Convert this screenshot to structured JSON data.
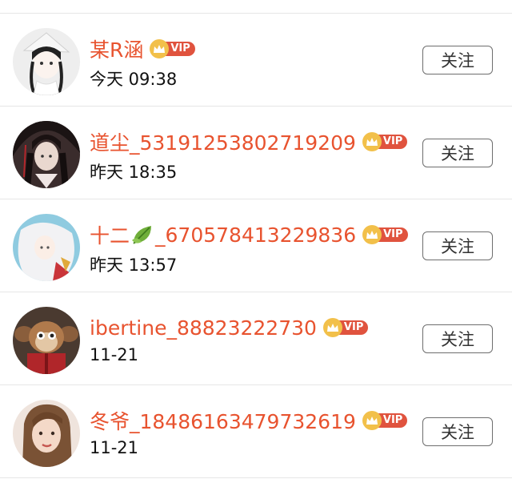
{
  "follow_label": "关注",
  "vip_label": "VIP",
  "rows": [
    {
      "name": "某R涵",
      "time": "今天 09:38",
      "vip": true,
      "avatar": "avatar-1"
    },
    {
      "name": "道尘_53191253802719209",
      "time": "昨天 18:35",
      "vip": true,
      "avatar": "avatar-2"
    },
    {
      "name_prefix": "十二",
      "name_suffix": "_670578413229836",
      "emoji": "leaf",
      "time": "昨天 13:57",
      "vip": true,
      "avatar": "avatar-3"
    },
    {
      "name": "ibertine_88823222730",
      "time": "11-21",
      "vip": true,
      "avatar": "avatar-4"
    },
    {
      "name": "冬爷_18486163479732619",
      "time": "11-21",
      "vip": true,
      "avatar": "avatar-5"
    }
  ],
  "colors": {
    "username": "#e8532f",
    "vip_badge": "#e0533e",
    "crown": "#f2c04a"
  }
}
